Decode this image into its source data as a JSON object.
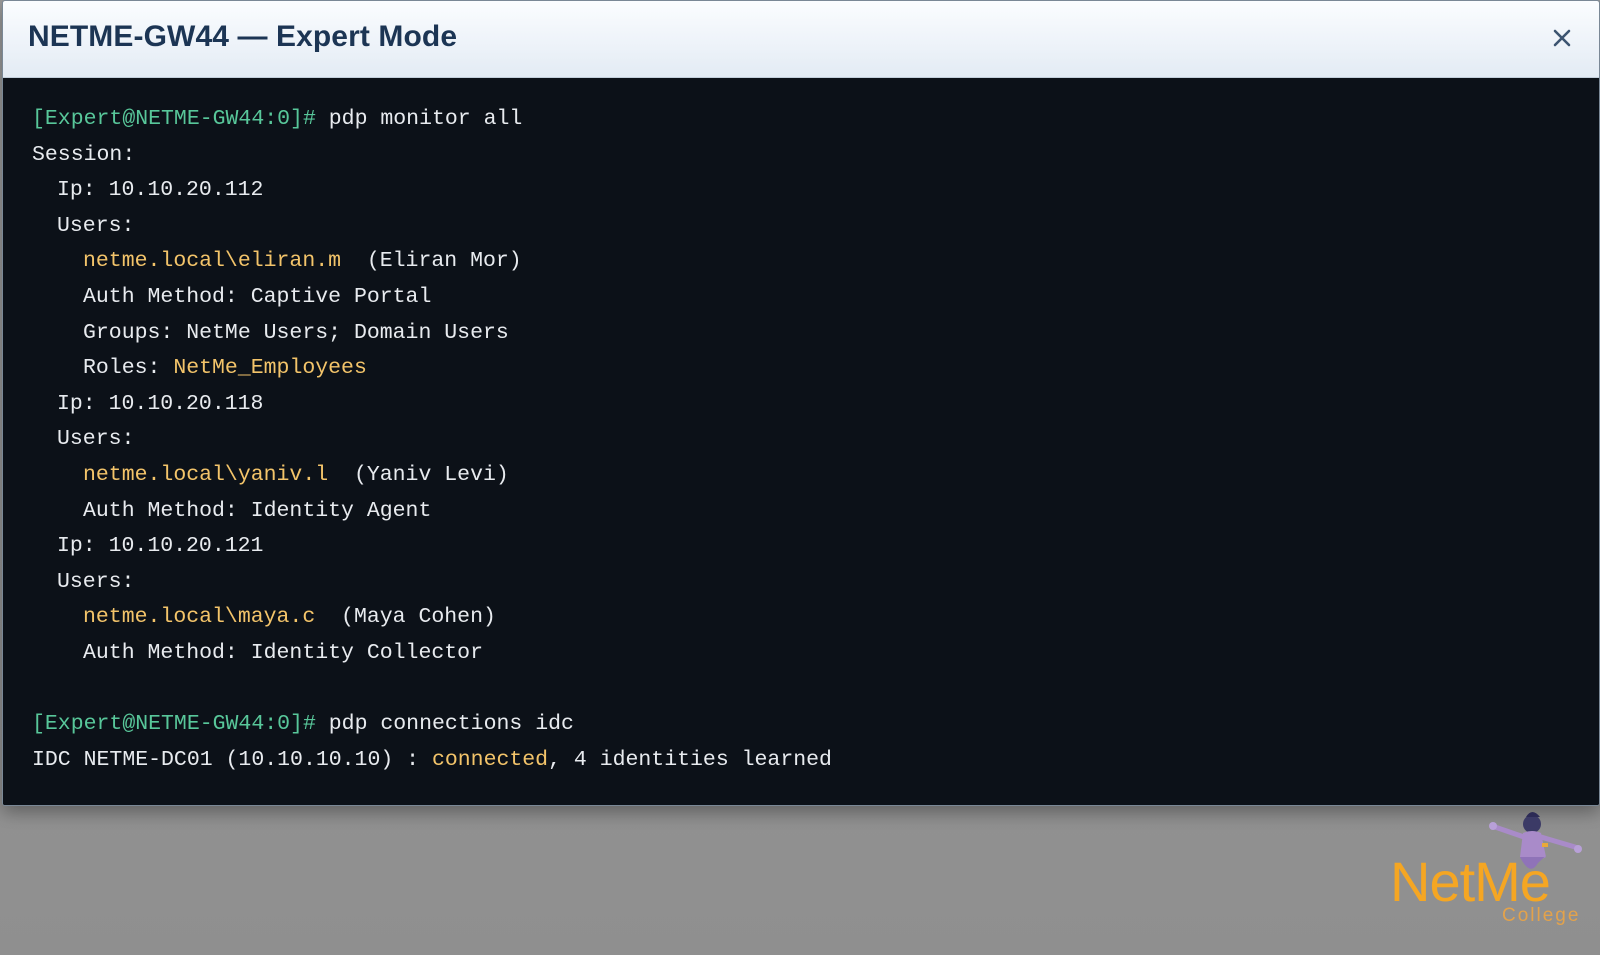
{
  "window": {
    "title": "NETME-GW44 — Expert Mode",
    "close_icon": "close-icon"
  },
  "terminal": {
    "prompt": "[Expert@NETME-GW44:0]#",
    "cmd1": " pdp monitor all",
    "session_label": "Session:",
    "sessions": [
      {
        "ip": "Ip: 10.10.20.112",
        "users_label": "Users:",
        "user": "netme.local\\eliran.m",
        "display_name": "  (Eliran Mor)",
        "auth": "Auth Method: Captive Portal",
        "groups": "Groups: NetMe Users; Domain Users",
        "roles_label": "Roles: ",
        "roles_value": "NetMe_Employees"
      },
      {
        "ip": "Ip: 10.10.20.118",
        "users_label": "Users:",
        "user": "netme.local\\yaniv.l",
        "display_name": "  (Yaniv Levi)",
        "auth": "Auth Method: Identity Agent"
      },
      {
        "ip": "Ip: 10.10.20.121",
        "users_label": "Users:",
        "user": "netme.local\\maya.c",
        "display_name": "  (Maya Cohen)",
        "auth": "Auth Method: Identity Collector"
      }
    ],
    "cmd2": " pdp connections idc",
    "idc_prefix": "IDC NETME-DC01 (10.10.10.10) : ",
    "idc_status": "connected",
    "idc_suffix": ", 4 identities learned"
  },
  "logo": {
    "word": "NetMe",
    "sub": "College"
  },
  "colors": {
    "prompt": "#58c79a",
    "highlight": "#f3c46a",
    "terminal_bg": "#0c1118",
    "title_text": "#1c3554",
    "logo_orange": "#f5a623"
  }
}
